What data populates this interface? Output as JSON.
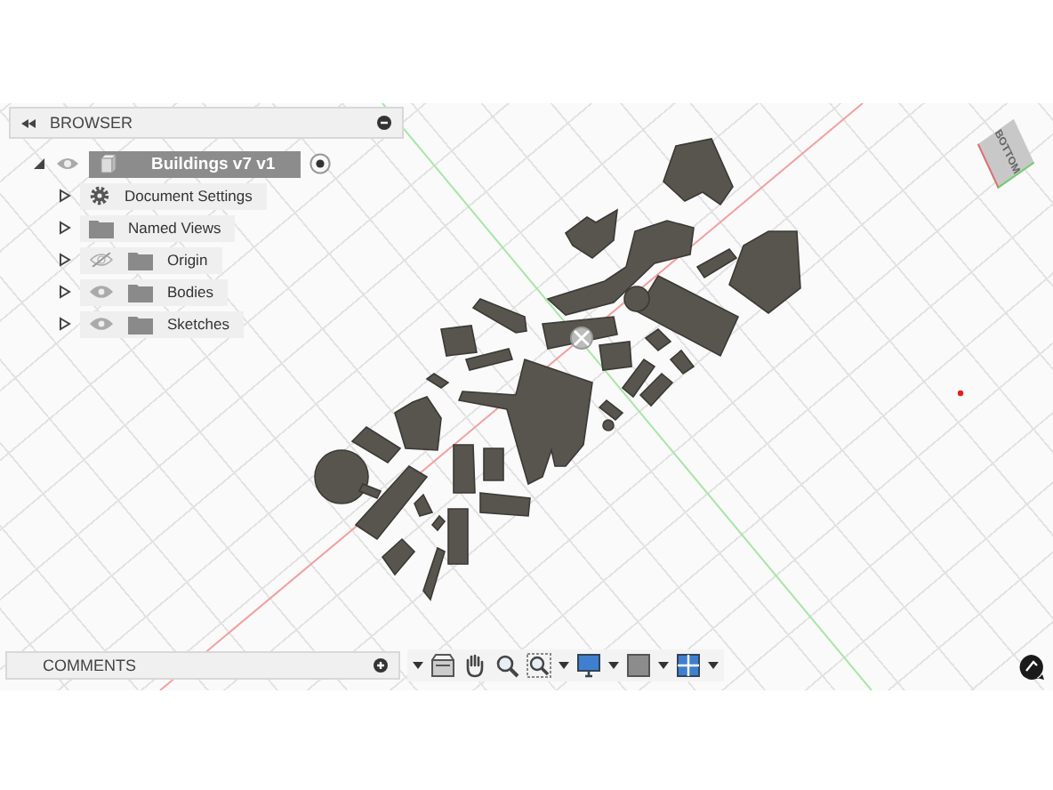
{
  "browser": {
    "title": "BROWSER",
    "root": {
      "label": "Buildings v7 v1",
      "expanded": true,
      "selected": true,
      "visible": true,
      "children": [
        {
          "label": "Document Settings",
          "kind": "settings",
          "expanded": false,
          "selected": false
        },
        {
          "label": "Named Views",
          "kind": "folder",
          "expanded": false,
          "selected": false
        },
        {
          "label": "Origin",
          "kind": "folder",
          "expanded": false,
          "selected": false,
          "visible": false
        },
        {
          "label": "Bodies",
          "kind": "folder",
          "expanded": false,
          "selected": false,
          "visible": true
        },
        {
          "label": "Sketches",
          "kind": "folder",
          "expanded": false,
          "selected": false,
          "visible": true
        }
      ]
    }
  },
  "viewcube": {
    "face": "BOTTOM"
  },
  "comments": {
    "title": "COMMENTS"
  }
}
